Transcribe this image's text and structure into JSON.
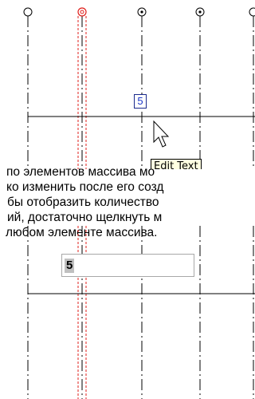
{
  "colors": {
    "axis_line": "#000000",
    "selected_element": "#e0201c",
    "count_text": "#1a35c8",
    "tooltip_bg": "#ffffe1",
    "selection_bg": "#c0c0c0"
  },
  "top_view": {
    "element_count": "5",
    "tooltip": "Edit Text",
    "cursor_icon": "arrow-pointer-icon"
  },
  "caption": {
    "lines": [
      "по элементов массива мо",
      "ко изменить после его созд",
      "бы отобразить количество",
      "ий, достаточно щелкнуть м",
      "любом элементе массива."
    ]
  },
  "bottom_view": {
    "edit_value": "5"
  }
}
